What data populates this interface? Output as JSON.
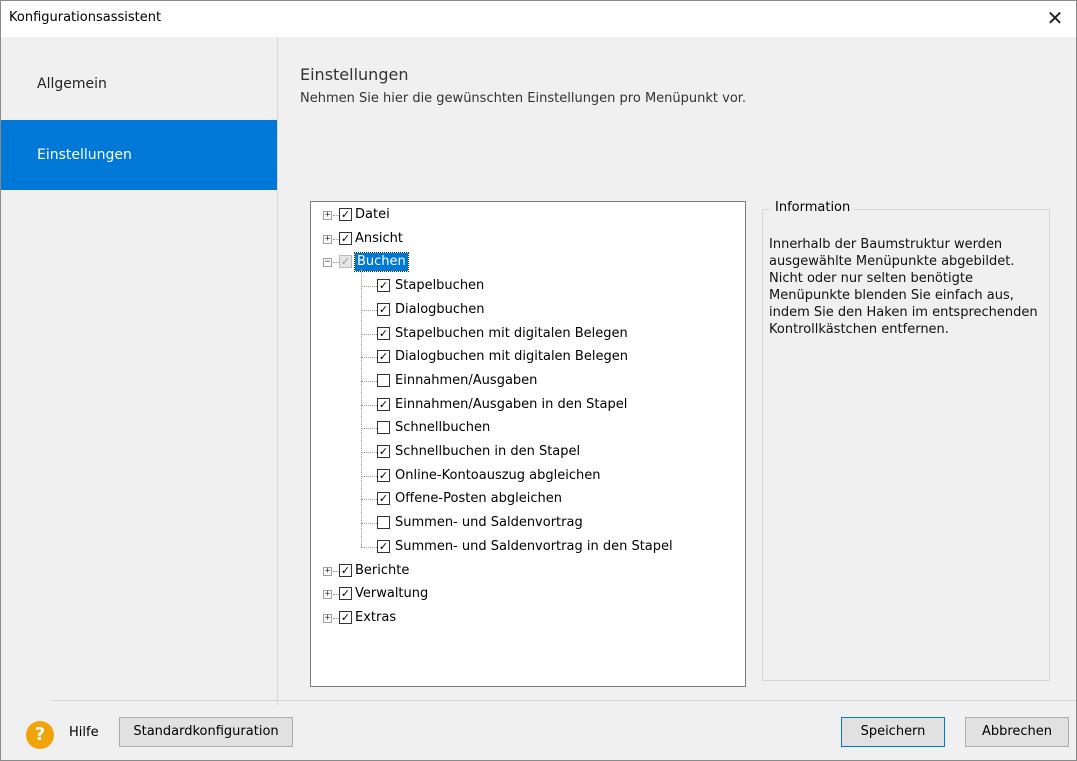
{
  "window": {
    "title": "Konfigurationsassistent",
    "close": "✕"
  },
  "sidebar": {
    "items": [
      {
        "label": "Allgemein"
      },
      {
        "label": "Einstellungen"
      }
    ]
  },
  "page": {
    "title": "Einstellungen",
    "subtitle": "Nehmen Sie hier die gewünschten Einstellungen pro Menüpunkt vor."
  },
  "tree": {
    "nodes": [
      {
        "label": "Datei",
        "checked": true,
        "expanded": false
      },
      {
        "label": "Ansicht",
        "checked": true,
        "expanded": false
      },
      {
        "label": "Buchen",
        "checked": true,
        "expanded": true,
        "selected": true,
        "children": [
          {
            "label": "Stapelbuchen",
            "checked": true
          },
          {
            "label": "Dialogbuchen",
            "checked": true
          },
          {
            "label": "Stapelbuchen mit digitalen Belegen",
            "checked": true
          },
          {
            "label": "Dialogbuchen mit digitalen Belegen",
            "checked": true
          },
          {
            "label": "Einnahmen/Ausgaben",
            "checked": false
          },
          {
            "label": "Einnahmen/Ausgaben in den Stapel",
            "checked": true
          },
          {
            "label": "Schnellbuchen",
            "checked": false
          },
          {
            "label": "Schnellbuchen in den Stapel",
            "checked": true
          },
          {
            "label": "Online-Kontoauszug abgleichen",
            "checked": true
          },
          {
            "label": "Offene-Posten abgleichen",
            "checked": true
          },
          {
            "label": "Summen- und Saldenvortrag",
            "checked": false
          },
          {
            "label": "Summen- und Saldenvortrag in den Stapel",
            "checked": true
          }
        ]
      },
      {
        "label": "Berichte",
        "checked": true,
        "expanded": false
      },
      {
        "label": "Verwaltung",
        "checked": true,
        "expanded": false
      },
      {
        "label": "Extras",
        "checked": true,
        "expanded": false
      }
    ]
  },
  "info": {
    "legend": "Information",
    "text": "Innerhalb der Baumstruktur werden ausgewählte Menüpunkte abgebildet. Nicht oder nur selten benötigte Menüpunkte blenden Sie einfach aus, indem Sie den Haken im entsprechenden Kontrollkästchen entfernen."
  },
  "footer": {
    "help_icon": "?",
    "help_label": "Hilfe",
    "default_label": "Standardkonfiguration",
    "save_label": "Speichern",
    "cancel_label": "Abbrechen"
  },
  "colors": {
    "accent": "#0078d7",
    "help": "#f0a30a"
  }
}
